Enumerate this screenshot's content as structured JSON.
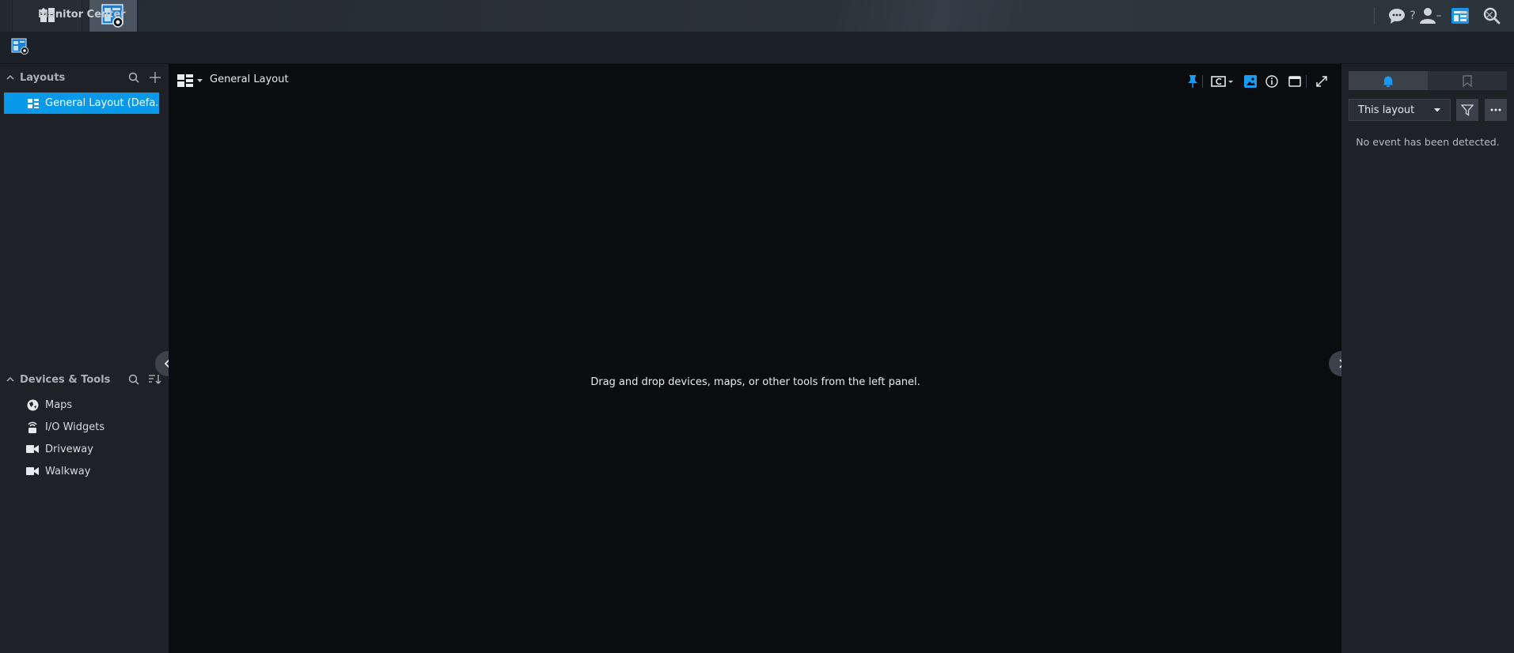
{
  "app": {
    "title": "Monitor Center"
  },
  "taskbar": {
    "buttons": [
      "main-menu",
      "monitor-center"
    ],
    "tray": [
      "chat-icon",
      "user-icon",
      "widgets-icon",
      "search-icon"
    ]
  },
  "window_controls": {
    "help": "?",
    "minimize": "–",
    "restore": "❐",
    "close": "✕"
  },
  "left_panel": {
    "layouts": {
      "title": "Layouts",
      "items": [
        {
          "label": "General Layout (Defa...",
          "selected": true
        }
      ]
    },
    "devices": {
      "title": "Devices & Tools",
      "items": [
        {
          "label": "Maps",
          "icon": "map-icon"
        },
        {
          "label": "I/O Widgets",
          "icon": "io-widget-icon"
        },
        {
          "label": "Driveway",
          "icon": "camera-icon"
        },
        {
          "label": "Walkway",
          "icon": "camera-icon"
        }
      ]
    }
  },
  "main": {
    "layout_title": "General Layout",
    "empty_message": "Drag and drop devices, maps, or other tools from the left panel."
  },
  "right_panel": {
    "tabs": [
      "bell-icon",
      "bookmark-icon"
    ],
    "filter_select": "This layout",
    "empty_message": "No event has been detected."
  },
  "colors": {
    "accent": "#0a98e8",
    "taskbar": "#2a323b",
    "panel": "#1e2227",
    "viewport": "#0b0c0e"
  }
}
